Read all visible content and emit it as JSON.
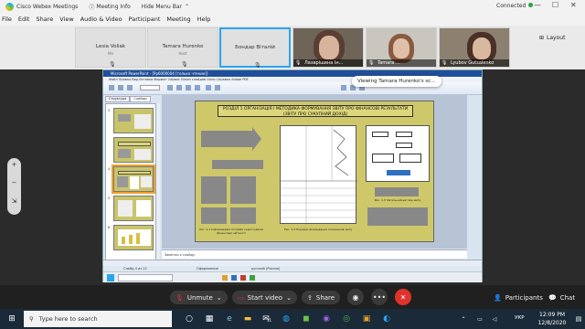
{
  "titlebar": {
    "app_title": "Cisco Webex Meetings",
    "meeting_info": "Meeting Info",
    "hide_menu": "Hide Menu Bar",
    "hide_menu_chevron": "⌃",
    "status": "Connected",
    "min": "—",
    "max": "☐",
    "close": "✕"
  },
  "menu": [
    "File",
    "Edit",
    "Share",
    "View",
    "Audio & Video",
    "Participant",
    "Meeting",
    "Help"
  ],
  "participants": [
    {
      "name": "Lesia Voliak",
      "sub": "Me",
      "video": false
    },
    {
      "name": "Tamara Hurenko",
      "sub": "Host",
      "video": false
    },
    {
      "name": "Бондар Віталій",
      "sub": "",
      "video": false,
      "active": true
    },
    {
      "name": "Лазарішина Ін...",
      "sub": "",
      "video": true
    },
    {
      "name": "Tamara ...",
      "sub": "",
      "video": true
    },
    {
      "name": "Lyubov Gutsalenko",
      "sub": "",
      "video": true
    }
  ],
  "layout_label": "Layout",
  "viewing_banner": "Viewing Tamara Hurenko's sc...",
  "zoom_controls": [
    "+",
    "−",
    "⇲"
  ],
  "powerpoint": {
    "window_title": "Microsoft PowerPoint - [Pp6000004 [только чтение]]",
    "menu_text": "Файл  Правка  Вид  Вставка  Формат  Сервис  Показ слайдов  Окно  Справка  Adobe PDF",
    "tabs": [
      "Структура",
      "Слайды"
    ],
    "slide_title_line1": "РОЗДІЛ 1 ОРГАНІЗАЦІЯ І МЕТОДИКА ФОРМУВАННЯ ЗВІТУ ПРО ФІНАНСОВІ РЕЗУЛЬТАТИ",
    "slide_title_line2": "(ЗВІТУ ПРО СУКУПНИЙ ДОХІД)",
    "slide_caption_left": "Рис. 1.1 Інформаційні потреби користувачів фінансової звітності",
    "slide_caption_mid": "Рис. 1.2 Порядок формування показників звіту",
    "slide_caption_right": "Рис. 1.3 Загальний вигляд звіту",
    "notes_placeholder": "Заметки к слайду",
    "status_slide": "Слайд 4 из 12",
    "status_theme": "Оформление",
    "status_lang": "русский (Россия)",
    "thumb_numbers": [
      "3",
      "4",
      "5",
      "6"
    ]
  },
  "controls": {
    "unmute": "Unmute",
    "start_video": "Start video",
    "share": "Share",
    "participants": "Participants",
    "chat": "Chat",
    "more": "•••",
    "end": "✕"
  },
  "taskbar": {
    "search_placeholder": "Type here to search",
    "lang": "УКР",
    "time": "12:09 PM",
    "date": "12/8/2020",
    "badge": "31"
  },
  "colors": {
    "accent": "#2aa4ef",
    "end_button": "#e0322b",
    "slide_bg": "#cfc86a",
    "connected": "#2ea043"
  }
}
